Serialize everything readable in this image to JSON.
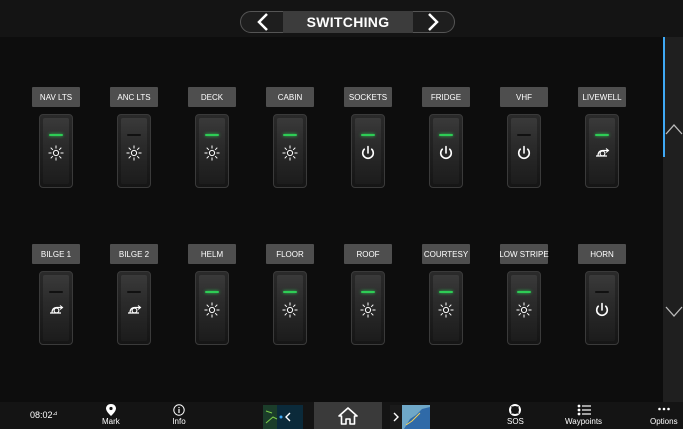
{
  "header": {
    "title": "SWITCHING",
    "prev_icon": "chevron-left-icon",
    "next_icon": "chevron-right-icon"
  },
  "switches": [
    {
      "label": "NAV LTS",
      "led": "on",
      "icon": "light"
    },
    {
      "label": "ANC LTS",
      "led": "off",
      "icon": "light"
    },
    {
      "label": "DECK",
      "led": "on",
      "icon": "light"
    },
    {
      "label": "CABIN",
      "led": "on",
      "icon": "light"
    },
    {
      "label": "SOCKETS",
      "led": "on",
      "icon": "power"
    },
    {
      "label": "FRIDGE",
      "led": "on",
      "icon": "power"
    },
    {
      "label": "VHF",
      "led": "off",
      "icon": "power"
    },
    {
      "label": "LIVEWELL",
      "led": "on",
      "icon": "pump"
    },
    {
      "label": "BILGE 1",
      "led": "off",
      "icon": "pump"
    },
    {
      "label": "BILGE 2",
      "led": "off",
      "icon": "pump"
    },
    {
      "label": "HELM",
      "led": "on",
      "icon": "light"
    },
    {
      "label": "FLOOR",
      "led": "on",
      "icon": "light"
    },
    {
      "label": "ROOF",
      "led": "on",
      "icon": "light"
    },
    {
      "label": "COURTESY",
      "led": "on",
      "icon": "light"
    },
    {
      "label": "LOW STRIPE",
      "led": "on",
      "icon": "light"
    },
    {
      "label": "HORN",
      "led": "off",
      "icon": "power"
    }
  ],
  "colors": {
    "led_on": "#2ecc55",
    "scroll_accent": "#3fa9f5"
  },
  "bottom": {
    "time": "08:02",
    "mark_label": "Mark",
    "info_label": "Info",
    "sos_label": "SOS",
    "waypoints_label": "Waypoints",
    "options_label": "Options"
  }
}
